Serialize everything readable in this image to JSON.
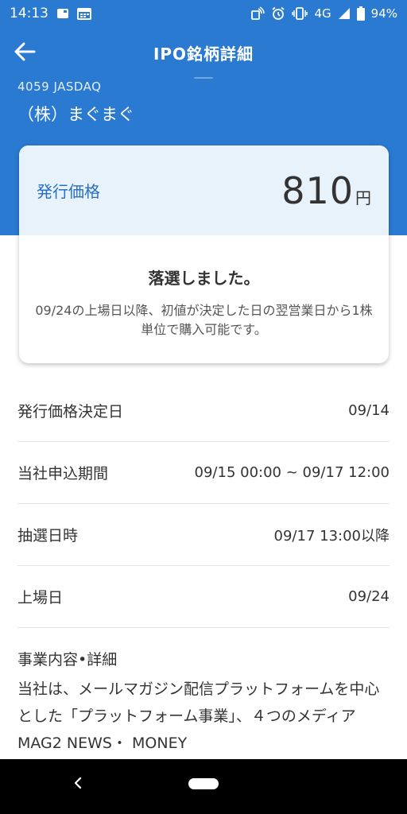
{
  "status_bar": {
    "time": "14:13",
    "network": "4G",
    "battery": "94%"
  },
  "app_bar": {
    "title": "IPO銘柄詳細"
  },
  "stock": {
    "code_market": "4059 JASDAQ",
    "name": "（株）まぐまぐ"
  },
  "card": {
    "price_label": "発行価格",
    "price_value": "810",
    "price_unit": "円",
    "result_title": "落選しました。",
    "result_desc": "09/24の上場日以降、初値が決定した日の翌営業日から1株単位で購入可能です。"
  },
  "details": [
    {
      "label": "発行価格決定日",
      "value": "09/14"
    },
    {
      "label": "当社申込期間",
      "value": "09/15 00:00 ~ 09/17 12:00"
    },
    {
      "label": "抽選日時",
      "value": "09/17 13:00以降"
    },
    {
      "label": "上場日",
      "value": "09/24"
    }
  ],
  "business": {
    "title": "事業内容•詳細",
    "text": "当社は、メールマガジン配信プラットフォームを中心とした「プラットフォーム事業」、４つのメディアMAG2 NEWS・ MONEY"
  },
  "colors": {
    "primary": "#2a7ad2",
    "card_top": "#e7f2fb",
    "price_label": "#2a6fbf"
  },
  "icons": {
    "back": "arrow-left-icon",
    "nav_back": "chevron-left-icon",
    "nav_home": "home-pill-icon"
  }
}
